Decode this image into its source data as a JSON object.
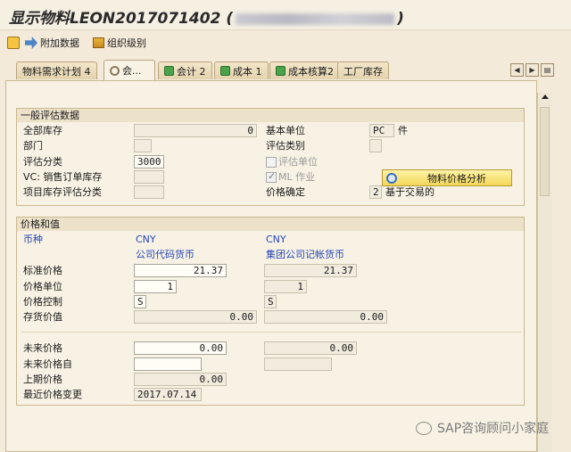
{
  "window": {
    "title_prefix": "显示物料",
    "title_material": "LEON2017071402",
    "title_paren_open": "(",
    "title_paren_close": ")"
  },
  "toolbar": {
    "additional_data": "附加数据",
    "org_levels": "组织级别"
  },
  "tabs": [
    {
      "label": "物料需求计划 4",
      "icon": "none"
    },
    {
      "label": "会...",
      "icon": "gear-icon"
    },
    {
      "label": "会计 2",
      "icon": "check-icon"
    },
    {
      "label": "成本 1",
      "icon": "check-icon"
    },
    {
      "label": "成本核算2",
      "icon": "check-icon"
    },
    {
      "label": "工厂库存",
      "icon": "none"
    }
  ],
  "general": {
    "title": "一般评估数据",
    "total_stock_label": "全部库存",
    "total_stock_value": "0",
    "base_unit_label": "基本单位",
    "base_unit_value": "PC",
    "base_unit_text": "件",
    "division_label": "部门",
    "division_value": "",
    "valuation_cat_label": "评估类别",
    "valuation_cat_value": "",
    "valuation_class_label": "评估分类",
    "valuation_class_value": "3000",
    "valuation_unit_label": "评估单位",
    "vc_label": "VC: 销售订单库存",
    "vc_value": "",
    "ml_label": "ML 作业",
    "ml_checked": true,
    "project_label": "项目库存评估分类",
    "project_value": "",
    "price_det_label": "价格确定",
    "price_det_value": "2",
    "price_det_text": "基于交易的",
    "analysis_button": "物料价格分析"
  },
  "prices": {
    "title": "价格和值",
    "currency_label": "币种",
    "col1_currency": "CNY",
    "col1_name": "公司代码货币",
    "col2_currency": "CNY",
    "col2_name": "集团公司记帐货币",
    "standard_price_label": "标准价格",
    "standard_price_1": "21.37",
    "standard_price_2": "21.37",
    "price_unit_label": "价格单位",
    "price_unit_1": "1",
    "price_unit_2": "1",
    "price_control_label": "价格控制",
    "price_control_1": "S",
    "price_control_2": "S",
    "stock_value_label": "存货价值",
    "stock_value_1": "0.00",
    "stock_value_2": "0.00",
    "future_price_label": "未来价格",
    "future_price_1": "0.00",
    "future_price_2": "0.00",
    "future_from_label": "未来价格自",
    "future_from_1": "",
    "future_from_2": "",
    "prev_price_label": "上期价格",
    "prev_price_1": "0.00",
    "last_change_label": "最近价格变更",
    "last_change_1": "2017.07.14"
  },
  "watermark": "SAP咨询顾问小家庭"
}
